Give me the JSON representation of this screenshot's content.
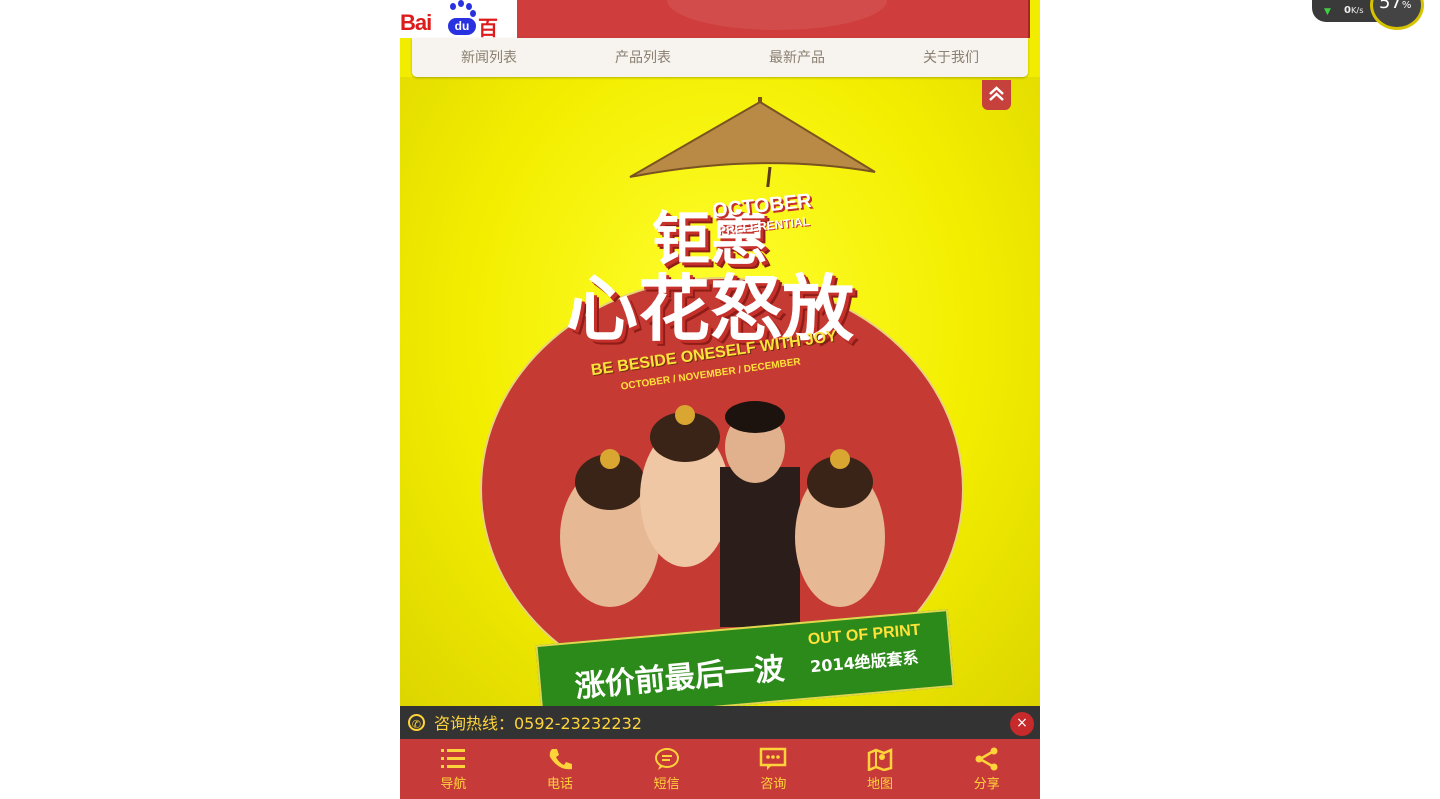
{
  "header": {
    "logo_text_bai": "Bai",
    "logo_text_du": "du",
    "logo_text_cn": "百度"
  },
  "nav": {
    "items": [
      "新闻列表",
      "产品列表",
      "最新产品",
      "关于我们"
    ]
  },
  "banner": {
    "title_line1": "钜惠",
    "title_line2": "心花怒放",
    "october": "OCTOBER",
    "preferential": "PREFERENTIAL",
    "slogan": "BE BESIDE ONESELF WITH JOY",
    "months": "OCTOBER / NOVEMBER / DECEMBER",
    "green_cn": "涨价前最后一波",
    "green_en": "OUT OF PRINT",
    "green_year": "2014绝版套系"
  },
  "hotline": {
    "text": "咨询热线：0592-23232232",
    "close": "×"
  },
  "bottom_bar": {
    "items": [
      {
        "label": "导航",
        "icon": "list-icon"
      },
      {
        "label": "电话",
        "icon": "phone-icon"
      },
      {
        "label": "短信",
        "icon": "chat-bubble-icon"
      },
      {
        "label": "咨询",
        "icon": "message-icon"
      },
      {
        "label": "地图",
        "icon": "map-icon"
      },
      {
        "label": "分享",
        "icon": "share-icon"
      }
    ]
  },
  "widget": {
    "speed": "0",
    "speed_unit": "K/s",
    "percent": "57",
    "percent_sign": "%"
  },
  "colors": {
    "brand_red": "#c73a3a",
    "accent_yellow": "#ffd43a",
    "banner_yellow": "#f1ec00"
  }
}
